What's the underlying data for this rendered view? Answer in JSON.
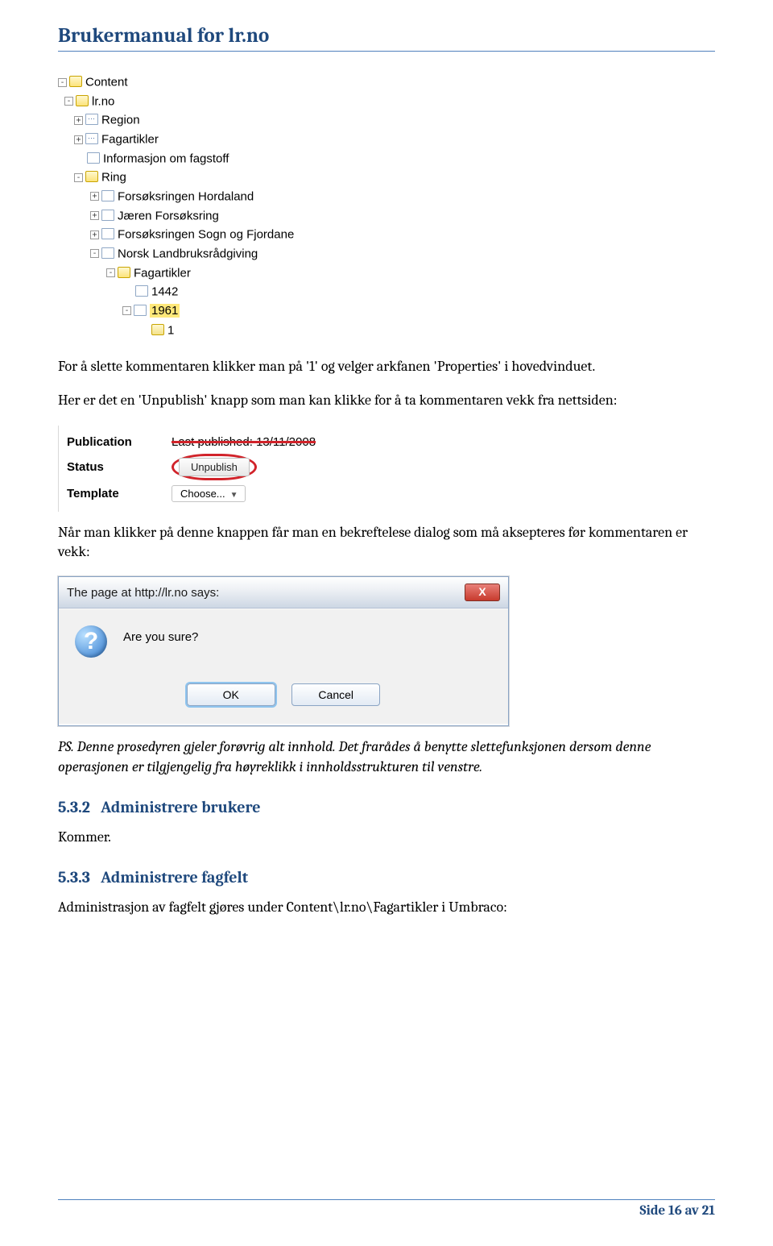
{
  "header": {
    "title": "Brukermanual for lr.no"
  },
  "tree": {
    "root_label": "Content",
    "lr_label": "lr.no",
    "region": "Region",
    "fagartikler": "Fagartikler",
    "info_fagstoff": "Informasjon om fagstoff",
    "ring": "Ring",
    "ring_children": {
      "hordaland": "Forsøksringen Hordaland",
      "jaeren": "Jæren Forsøksring",
      "sogn": "Forsøksringen Sogn og Fjordane",
      "nlr": "Norsk Landbruksrådgiving"
    },
    "nlr_fagartikler": "Fagartikler",
    "n1442": "1442",
    "n1961": "1961",
    "n1": "1"
  },
  "para1": "For å slette kommentaren klikker man på '1' og velger arkfanen 'Properties' i hovedvinduet.",
  "para2": "Her er det en 'Unpublish' knapp som man kan klikke for å ta kommentaren vekk fra nettsiden:",
  "properties": {
    "publication_label": "Publication",
    "status_label": "Status",
    "template_label": "Template",
    "last_published": "Last published: 13/11/2008",
    "unpublish_btn": "Unpublish",
    "choose": "Choose..."
  },
  "para3": "Når man klikker på denne knappen får man en bekreftelese dialog som må aksepteres før kommentaren er vekk:",
  "dialog": {
    "title": "The page at http://lr.no says:",
    "message": "Are you sure?",
    "ok": "OK",
    "cancel": "Cancel",
    "close": "X"
  },
  "para_ps": "PS. Denne prosedyren gjeler forøvrig alt innhold. Det frarådes å benytte slettefunksjonen dersom denne operasjonen er tilgjengelig fra høyreklikk i innholdsstrukturen til venstre.",
  "sections": {
    "s532_num": "5.3.2",
    "s532_title": "Administrere brukere",
    "s532_body": "Kommer.",
    "s533_num": "5.3.3",
    "s533_title": "Administrere fagfelt",
    "s533_body": "Administrasjon av fagfelt gjøres under Content\\lr.no\\Fagartikler i Umbraco:"
  },
  "footer": {
    "text": "Side 16 av 21"
  }
}
